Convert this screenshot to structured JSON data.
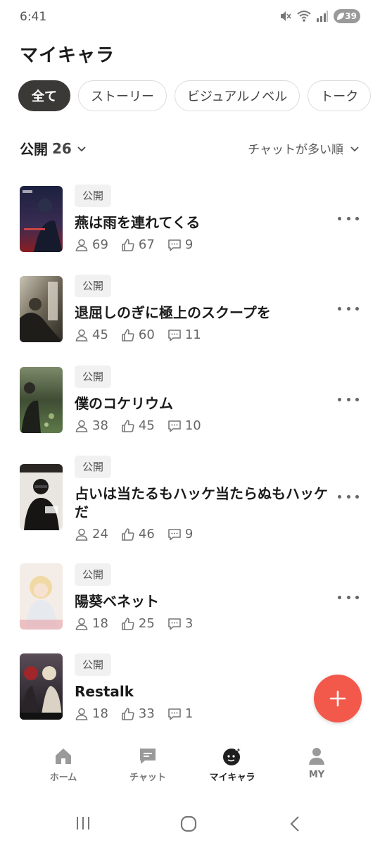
{
  "status_bar": {
    "time": "6:41",
    "battery": "39"
  },
  "header": {
    "title": "マイキャラ"
  },
  "filters": {
    "chips": [
      {
        "label": "全て",
        "active": true
      },
      {
        "label": "ストーリー",
        "active": false
      },
      {
        "label": "ビジュアルノベル",
        "active": false
      },
      {
        "label": "トーク",
        "active": false
      }
    ],
    "visibility_label": "公開",
    "visibility_count": "26",
    "sort_label": "チャットが多い順"
  },
  "characters": [
    {
      "badge": "公開",
      "name": "燕は雨を連れてくる",
      "users": "69",
      "likes": "67",
      "comments": "9"
    },
    {
      "badge": "公開",
      "name": "退屈しのぎに極上のスクープを",
      "users": "45",
      "likes": "60",
      "comments": "11"
    },
    {
      "badge": "公開",
      "name": "僕のコケリウム",
      "users": "38",
      "likes": "45",
      "comments": "10"
    },
    {
      "badge": "公開",
      "name": "占いは当たるもハッケ当たらぬもハッケだ",
      "users": "24",
      "likes": "46",
      "comments": "9"
    },
    {
      "badge": "公開",
      "name": "陽葵ベネット",
      "users": "18",
      "likes": "25",
      "comments": "3"
    },
    {
      "badge": "公開",
      "name": "Restalk",
      "users": "18",
      "likes": "33",
      "comments": "1"
    }
  ],
  "bottom_nav": [
    {
      "label": "ホーム",
      "icon": "home-icon",
      "active": false
    },
    {
      "label": "チャット",
      "icon": "chat-icon",
      "active": false
    },
    {
      "label": "マイキャラ",
      "icon": "my-character-icon",
      "active": true
    },
    {
      "label": "MY",
      "icon": "profile-icon",
      "active": false
    }
  ],
  "colors": {
    "accent": "#f2594b",
    "chip_active": "#3b3936",
    "badge_bg": "#f1f1f1"
  }
}
